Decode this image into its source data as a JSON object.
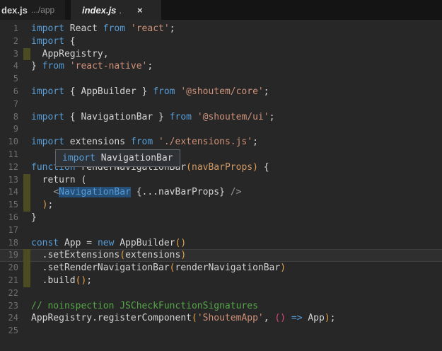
{
  "tabs": {
    "left_partial": {
      "filename": "dex.js",
      "path_hint": ".../app"
    },
    "active": {
      "filename": "index.js",
      "modified_dot": ".",
      "close_icon": "×"
    }
  },
  "tooltip": {
    "keyword": "import",
    "symbol": "NavigationBar"
  },
  "colors": {
    "editor_background": "#272727",
    "tabbar_background": "#141414",
    "active_tab_background": "#262626",
    "keyword": "#569cd6",
    "string": "#ce9178",
    "comment": "#57a64a",
    "text": "#d4d4d4",
    "bracket_level1_gold": "#e2a24b",
    "bracket_level2_pink": "#e0447f",
    "parameter": "#d19a66",
    "word_highlight_background": "#264f78",
    "changed_line_marker": "#4c4c22",
    "line_number": "#6f6f6f"
  },
  "editor": {
    "lines": [
      {
        "n": 1,
        "tokens": [
          [
            "kw",
            "import "
          ],
          [
            "tx",
            "React "
          ],
          [
            "kw",
            "from "
          ],
          [
            "st",
            "'react'"
          ],
          [
            "tx",
            ";"
          ]
        ]
      },
      {
        "n": 2,
        "tokens": [
          [
            "kw",
            "import "
          ],
          [
            "tx",
            "{"
          ]
        ]
      },
      {
        "n": 3,
        "marker": true,
        "tokens": [
          [
            "tx",
            "  AppRegistry,"
          ]
        ]
      },
      {
        "n": 4,
        "tokens": [
          [
            "tx",
            "} "
          ],
          [
            "kw",
            "from "
          ],
          [
            "st",
            "'react-native'"
          ],
          [
            "tx",
            ";"
          ]
        ]
      },
      {
        "n": 5,
        "tokens": []
      },
      {
        "n": 6,
        "tokens": [
          [
            "kw",
            "import "
          ],
          [
            "tx",
            "{ AppBuilder } "
          ],
          [
            "kw",
            "from "
          ],
          [
            "st",
            "'@shoutem/core'"
          ],
          [
            "tx",
            ";"
          ]
        ]
      },
      {
        "n": 7,
        "tokens": []
      },
      {
        "n": 8,
        "tokens": [
          [
            "kw",
            "import "
          ],
          [
            "tx",
            "{ NavigationBar } "
          ],
          [
            "kw",
            "from "
          ],
          [
            "st",
            "'@shoutem/ui'"
          ],
          [
            "tx",
            ";"
          ]
        ]
      },
      {
        "n": 9,
        "tokens": []
      },
      {
        "n": 10,
        "tokens": [
          [
            "kw",
            "import "
          ],
          [
            "tx",
            "extensions "
          ],
          [
            "kw",
            "from "
          ],
          [
            "st",
            "'./extensions.js'"
          ],
          [
            "tx",
            ";"
          ]
        ]
      },
      {
        "n": 11,
        "tokens": []
      },
      {
        "n": 12,
        "tokens": [
          [
            "kw",
            "function "
          ],
          [
            "tx",
            "renderNavigationBar"
          ],
          [
            "b1",
            "("
          ],
          [
            "pm",
            "navBarProps"
          ],
          [
            "b1",
            ")"
          ],
          [
            "tx",
            " {"
          ]
        ]
      },
      {
        "n": 13,
        "marker": true,
        "tokens": [
          [
            "tx",
            "  return ("
          ]
        ]
      },
      {
        "n": 14,
        "marker": true,
        "tokens": [
          [
            "tx",
            "    "
          ],
          [
            "gr",
            "<"
          ],
          [
            "cmp",
            "NavigationBar"
          ],
          [
            "tx",
            " {...navBarProps} "
          ],
          [
            "gr",
            "/>"
          ]
        ]
      },
      {
        "n": 15,
        "marker": true,
        "tokens": [
          [
            "tx",
            "  "
          ],
          [
            "b1",
            ")"
          ],
          [
            "tx",
            ";"
          ]
        ]
      },
      {
        "n": 16,
        "tokens": [
          [
            "tx",
            "}"
          ]
        ]
      },
      {
        "n": 17,
        "tokens": []
      },
      {
        "n": 18,
        "tokens": [
          [
            "kw",
            "const "
          ],
          [
            "tx",
            "App = "
          ],
          [
            "kw",
            "new "
          ],
          [
            "tx",
            "AppBuilder"
          ],
          [
            "b1",
            "()"
          ]
        ]
      },
      {
        "n": 19,
        "marker": true,
        "current": true,
        "tokens": [
          [
            "tx",
            "  .setExtensions"
          ],
          [
            "b1",
            "("
          ],
          [
            "tx",
            "extensions"
          ],
          [
            "b1",
            ")"
          ]
        ]
      },
      {
        "n": 20,
        "marker": true,
        "tokens": [
          [
            "tx",
            "  .setRenderNavigationBar"
          ],
          [
            "b1",
            "("
          ],
          [
            "tx",
            "renderNavigationBar"
          ],
          [
            "b1",
            ")"
          ]
        ]
      },
      {
        "n": 21,
        "marker": true,
        "tokens": [
          [
            "tx",
            "  .build"
          ],
          [
            "b1",
            "()"
          ],
          [
            "tx",
            ";"
          ]
        ]
      },
      {
        "n": 22,
        "tokens": []
      },
      {
        "n": 23,
        "tokens": [
          [
            "cm",
            "// noinspection JSCheckFunctionSignatures"
          ]
        ]
      },
      {
        "n": 24,
        "tokens": [
          [
            "tx",
            "AppRegistry.registerComponent"
          ],
          [
            "b1",
            "("
          ],
          [
            "st",
            "'ShoutemApp'"
          ],
          [
            "tx",
            ", "
          ],
          [
            "b2",
            "()"
          ],
          [
            "kw",
            " => "
          ],
          [
            "tx",
            "App"
          ],
          [
            "b1",
            ")"
          ],
          [
            "tx",
            ";"
          ]
        ]
      },
      {
        "n": 25,
        "tokens": []
      }
    ]
  }
}
